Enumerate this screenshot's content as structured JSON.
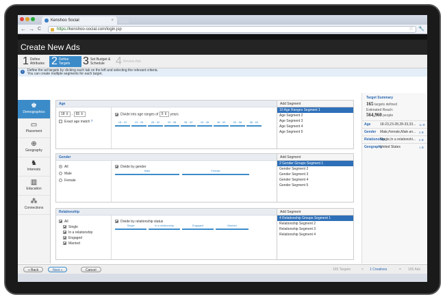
{
  "browser": {
    "tab_title": "Kenshoo Social",
    "tab_close": "×",
    "back": "←",
    "forward": "→",
    "reload": "C",
    "url_scheme": "https://",
    "url_rest": "kenshoo-social.com/login.jsp",
    "star": "☆"
  },
  "page": {
    "title": "Create New Ads"
  },
  "steps": [
    {
      "num": "1",
      "label": "Define Attributes"
    },
    {
      "num": "2",
      "label": "Define Targets"
    },
    {
      "num": "3",
      "label": "Set Budget & Schedule"
    },
    {
      "num": "4",
      "label": "Review Ads"
    }
  ],
  "info": {
    "line1": "Define the ad targets by clicking each tab on the left and selecting the relevant criteria.",
    "line2": "You can create multiple segments for each target."
  },
  "sidebar": [
    {
      "label": "Demographics",
      "icon": "person-icon"
    },
    {
      "label": "Placement",
      "icon": "monitor-icon"
    },
    {
      "label": "Geography",
      "icon": "globe-icon"
    },
    {
      "label": "Interests",
      "icon": "interests-icon"
    },
    {
      "label": "Education",
      "icon": "education-icon"
    },
    {
      "label": "Connections",
      "icon": "connections-icon"
    }
  ],
  "age": {
    "title": "Age",
    "from": "18",
    "dash": "-",
    "to": "65",
    "exact": "Exact age match",
    "help": "?",
    "divide_label": "Divide into age ranges of",
    "range_value": "5",
    "years": "years",
    "ranges": [
      "18 - 22",
      "23 - 28",
      "28 - 32",
      "33 - 38",
      "38 - 43",
      "43 - 48",
      "48 - 53",
      "53 - 58",
      "58 - 63"
    ],
    "add_segment": "Add Segment",
    "segments": [
      "10 Age Ranges Segment 1",
      "Age Segment 2",
      "Age Segment 3",
      "Age Segment 4",
      "Age Segment 5"
    ]
  },
  "gender": {
    "title": "Gender",
    "options": [
      "All",
      "Male",
      "Female"
    ],
    "divide_label": "Divide by gender",
    "col_male": "Male",
    "col_female": "Female",
    "add_segment": "Add Segment",
    "segments": [
      "2 Gender Groups Segment 1",
      "Gender Segment 2",
      "Gender Segment 3",
      "Gender Segment 4",
      "Gender Segment 5"
    ]
  },
  "relationship": {
    "title": "Relationship",
    "options": [
      "All",
      "Single",
      "In a relationship",
      "Engaged",
      "Married"
    ],
    "divide_label": "Divide by relationship status",
    "cols": [
      "Single",
      "In a relationship",
      "Engaged",
      "Married"
    ],
    "add_segment": "Add Segment",
    "segments": [
      "4 Relationship Groups Segment 1",
      "Relationship Segment 2",
      "Relationship Segment 3",
      "Relationship Segment 4"
    ]
  },
  "summary": {
    "title": "Target Summary",
    "targets_num": "165",
    "targets_label": "targets defined",
    "reach_label": "Estimated Reach:",
    "reach_num": "564,960",
    "reach_unit": "people",
    "rows": [
      {
        "k": "Age",
        "v": "18-23,23-28,28-33,33...",
        "c": "11"
      },
      {
        "k": "Gender",
        "v": "Male,Female,Male an...",
        "c": "3"
      },
      {
        "k": "Relationship",
        "v": "Single,In a relationshi...",
        "c": "5"
      },
      {
        "k": "Geography",
        "v": "United States",
        "c": "1"
      }
    ]
  },
  "footer": {
    "back": "« Back",
    "next": "Next »",
    "cancel": "Cancel",
    "targets": "165 Targets",
    "times": "×",
    "creatives": "1 Creatives",
    "equals": "=",
    "ads": "165 Ads"
  }
}
